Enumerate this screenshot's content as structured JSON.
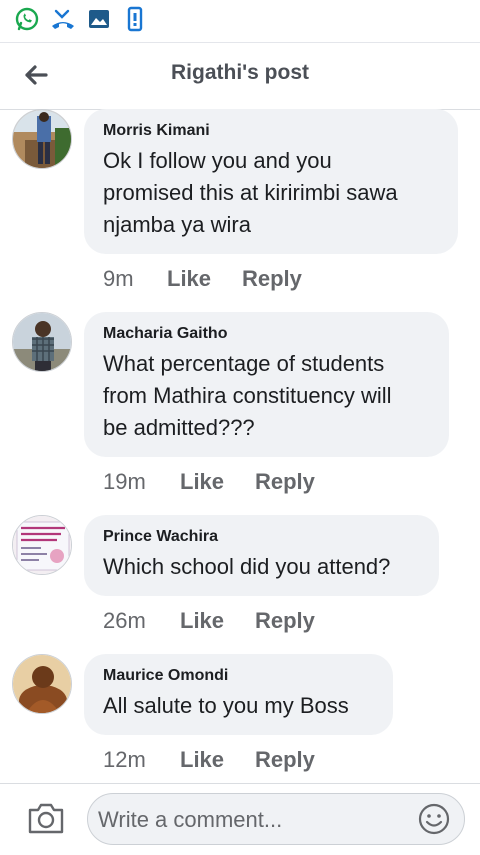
{
  "statusbar": {
    "icons": [
      "whatsapp-icon",
      "missed-call-icon",
      "gallery-icon",
      "phone-notification-icon"
    ]
  },
  "header": {
    "title": "Rigathi's post",
    "back_icon": "back-arrow-icon"
  },
  "comments": [
    {
      "author": "Morris Kimani",
      "text_lines": [
        "Ok I follow you and you",
        "promised this at kiririmbi  sawa",
        "njamba ya wira"
      ],
      "time": "9m",
      "like": "Like",
      "reply": "Reply"
    },
    {
      "author": "Macharia Gaitho",
      "text_lines": [
        "What percentage of students",
        "from Mathira constituency will",
        "be admitted???"
      ],
      "time": "19m",
      "like": "Like",
      "reply": "Reply"
    },
    {
      "author": "Prince Wachira",
      "text_lines": [
        "Which school did you attend?"
      ],
      "time": "26m",
      "like": "Like",
      "reply": "Reply"
    },
    {
      "author": "Maurice Omondi",
      "text_lines": [
        "All salute to you my Boss"
      ],
      "time": "12m",
      "like": "Like",
      "reply": "Reply"
    }
  ],
  "composer": {
    "placeholder": "Write a comment...",
    "camera_icon": "camera-icon",
    "emoji_icon": "emoji-icon"
  },
  "colors": {
    "bubble": "#f0f2f5",
    "secondary_text": "#65676b",
    "whatsapp": "#25d366",
    "accent_blue": "#1877f2"
  }
}
